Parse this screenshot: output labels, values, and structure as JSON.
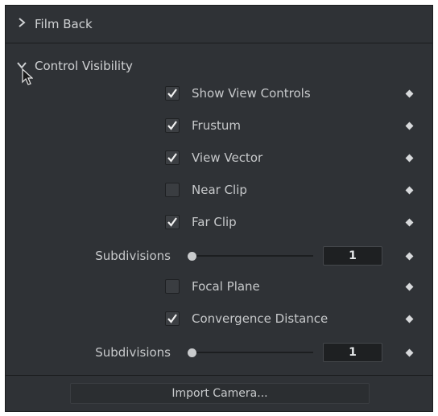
{
  "sections": {
    "film_back": {
      "label": "Film Back",
      "expanded": false
    },
    "control_visibility": {
      "label": "Control Visibility",
      "expanded": true
    }
  },
  "checkboxes": [
    {
      "label": "Show View Controls",
      "checked": true
    },
    {
      "label": "Frustum",
      "checked": true
    },
    {
      "label": "View Vector",
      "checked": true
    },
    {
      "label": "Near Clip",
      "checked": false
    },
    {
      "label": "Far Clip",
      "checked": true
    },
    {
      "label": "Focal Plane",
      "checked": false
    },
    {
      "label": "Convergence Distance",
      "checked": true
    }
  ],
  "subdivisions": [
    {
      "label": "Subdivisions",
      "value": "1"
    },
    {
      "label": "Subdivisions",
      "value": "1"
    }
  ],
  "footer": {
    "import_label": "Import Camera..."
  },
  "icons": {
    "expand": "chevron-right-icon",
    "collapse": "chevron-down-icon",
    "keyframe": "diamond-icon",
    "check": "check-icon",
    "cursor": "mouse-pointer-icon"
  },
  "colors": {
    "panel_bg": "#2f3236",
    "text": "#c7c9cb",
    "input_bg": "#1e2022"
  }
}
